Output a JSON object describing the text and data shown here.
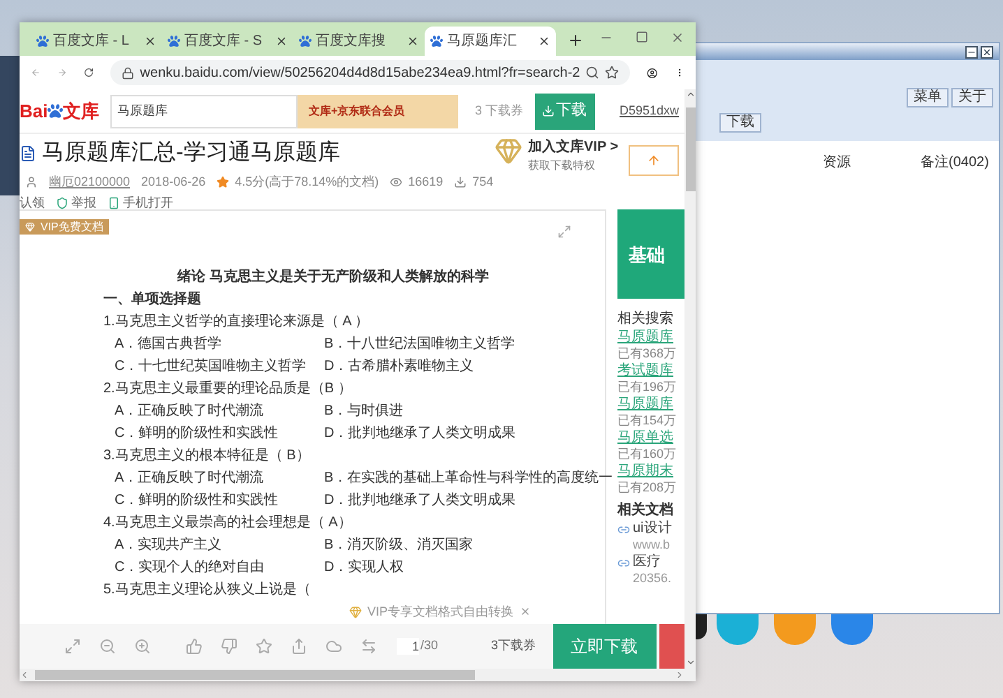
{
  "back_window": {
    "menu_buttons": [
      "菜单",
      "关于"
    ],
    "download_button": "下载",
    "columns": [
      "资源",
      "备注(0402)"
    ]
  },
  "browser": {
    "tabs": [
      {
        "title": "百度文库 - L",
        "selected": false
      },
      {
        "title": "百度文库 - S",
        "selected": false
      },
      {
        "title": "百度文库搜",
        "selected": false
      },
      {
        "title": "马原题库汇",
        "selected": true
      }
    ],
    "url": "wenku.baidu.com/view/50256204d4d8d15abe234ea9.html?fr=search-2"
  },
  "header": {
    "logo": [
      "Bai",
      "文库"
    ],
    "search_value": "马原题库",
    "banner": "文库+京东联合会员",
    "coupons": "3 下载券",
    "download_button": "下载",
    "username": "D5951dxw"
  },
  "doc": {
    "title": "马原题库汇总-学习通马原题库",
    "author": "幽厄02100000",
    "date": "2018-06-26",
    "rating": "4.5分(高于78.14%的文档)",
    "views": "16619",
    "downloads": "754",
    "actions": [
      "认领",
      "举报",
      "手机打开"
    ]
  },
  "vip": {
    "title": "加入文库VIP >",
    "subtitle": "获取下载特权"
  },
  "doc_tag": "VIP免费文档",
  "content": [
    {
      "kind": "heading",
      "text": "绪论 马克思主义是关于无产阶级和人类解放的科学"
    },
    {
      "kind": "section",
      "text": "一、单项选择题"
    },
    {
      "kind": "question",
      "text": "1.马克思主义哲学的直接理论来源是（  A  ）"
    },
    {
      "kind": "options",
      "items": [
        "A．德国古典哲学",
        "B．十八世纪法国唯物主义哲学"
      ]
    },
    {
      "kind": "options",
      "items": [
        "C．十七世纪英国唯物主义哲学",
        "D．古希腊朴素唯物主义"
      ]
    },
    {
      "kind": "question",
      "text": "2.马克思主义最重要的理论品质是（B      ）"
    },
    {
      "kind": "options",
      "items": [
        "A．正确反映了时代潮流",
        "B．与时俱进"
      ]
    },
    {
      "kind": "options",
      "items": [
        "C．鲜明的阶级性和实践性",
        "D．批判地继承了人类文明成果"
      ]
    },
    {
      "kind": "question",
      "text": "3.马克思主义的根本特征是（      B）"
    },
    {
      "kind": "options",
      "items": [
        "A．正确反映了时代潮流",
        "B．在实践的基础上革命性与科学性的高度统一"
      ]
    },
    {
      "kind": "options",
      "items": [
        "C．鲜明的阶级性和实践性",
        "D．批判地继承了人类文明成果"
      ]
    },
    {
      "kind": "question",
      "text": "4.马克思主义最崇高的社会理想是（    A）"
    },
    {
      "kind": "options",
      "items": [
        "A．实现共产主义",
        "B．消灭阶级、消灭国家"
      ]
    },
    {
      "kind": "options",
      "items": [
        "C．实现个人的绝对自由",
        "D．实现人权"
      ]
    },
    {
      "kind": "question",
      "text": "5.马克思主义理论从狭义上说是（"
    }
  ],
  "sidebar": {
    "banner": "基础",
    "search_title": "相关搜索",
    "searches": [
      {
        "title": "马原题库",
        "count": "已有368万"
      },
      {
        "title": "考试题库",
        "count": "已有196万"
      },
      {
        "title": "马原题库",
        "count": "已有154万"
      },
      {
        "title": "马原单选",
        "count": "已有160万"
      },
      {
        "title": "马原期末",
        "count": "已有208万"
      }
    ],
    "docs_title": "相关文档",
    "docs": [
      {
        "title": "ui设计",
        "source": "www.b"
      },
      {
        "title": "医疗",
        "source": "20356."
      }
    ]
  },
  "vip_popup": "VIP专享文档格式自由转换",
  "toolbar": {
    "page": "1",
    "total": "/30",
    "coupons": "3下载券",
    "download_button": "立即下载"
  }
}
